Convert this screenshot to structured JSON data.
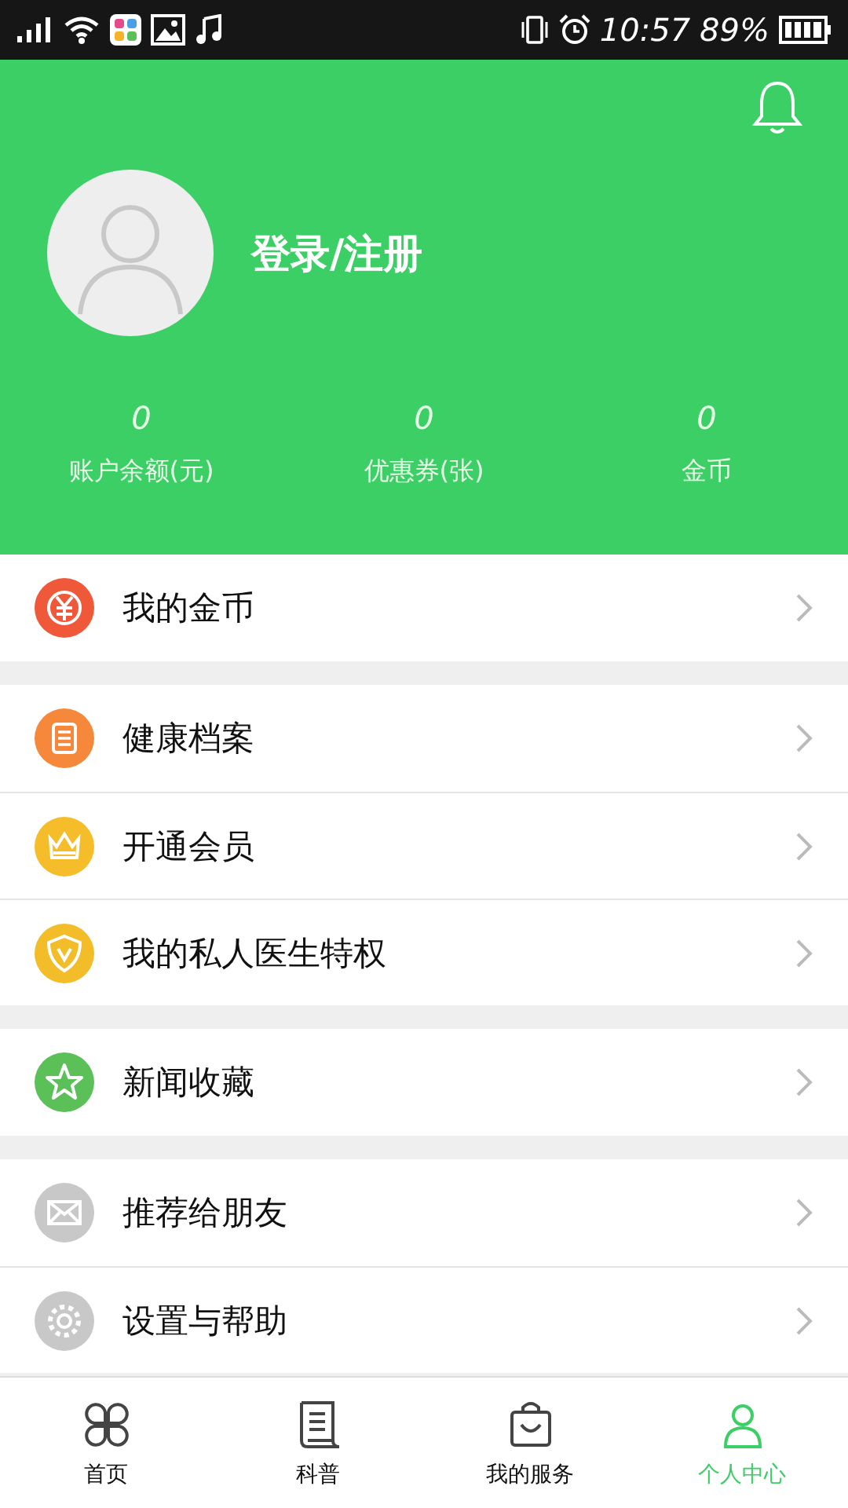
{
  "status_bar": {
    "time": "10:57",
    "battery": "89%"
  },
  "profile": {
    "login_label": "登录/注册",
    "has_notifications": false
  },
  "stats": [
    {
      "value": "0",
      "label": "账户余额(元)"
    },
    {
      "value": "0",
      "label": "优惠券(张)"
    },
    {
      "value": "0",
      "label": "金币"
    }
  ],
  "menu_groups": [
    [
      {
        "kind": "coin",
        "label": "我的金币",
        "color": "#f0583a"
      }
    ],
    [
      {
        "kind": "record",
        "label": "健康档案",
        "color": "#f5883a"
      },
      {
        "kind": "crown",
        "label": "开通会员",
        "color": "#f5bd2a"
      },
      {
        "kind": "shield",
        "label": "我的私人医生特权",
        "color": "#f2bd28"
      }
    ],
    [
      {
        "kind": "star",
        "label": "新闻收藏",
        "color": "#5cc058"
      }
    ],
    [
      {
        "kind": "mail",
        "label": "推荐给朋友",
        "color": "#c8c8c8"
      },
      {
        "kind": "gear",
        "label": "设置与帮助",
        "color": "#c8c8c8"
      }
    ]
  ],
  "bottom_nav": [
    {
      "kind": "clover",
      "label": "首页",
      "selected": false
    },
    {
      "kind": "scroll",
      "label": "科普",
      "selected": false
    },
    {
      "kind": "bag",
      "label": "我的服务",
      "selected": false
    },
    {
      "kind": "person",
      "label": "个人中心",
      "selected": true
    }
  ]
}
